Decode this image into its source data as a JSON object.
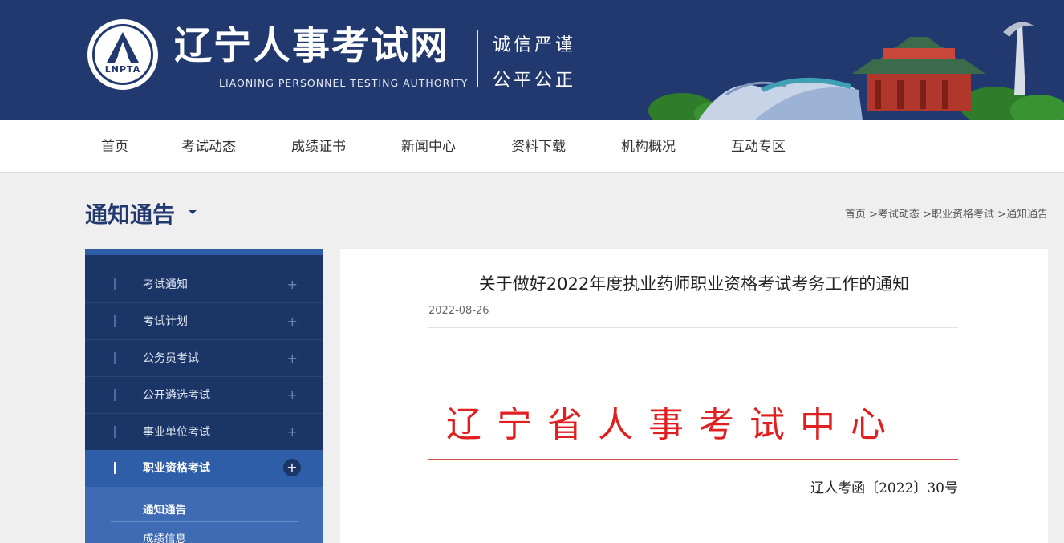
{
  "header": {
    "logo_abbr": "LNPTA",
    "site_title": "辽宁人事考试网",
    "site_subtitle": "LIAONING PERSONNEL TESTING AUTHORITY",
    "slogan_line1": "诚信严谨",
    "slogan_line2": "公平公正",
    "brand_color": "#21396e"
  },
  "nav": {
    "items": [
      "首页",
      "考试动态",
      "成绩证书",
      "新闻中心",
      "资料下载",
      "机构概况",
      "互动专区"
    ]
  },
  "section": {
    "title": "通知通告"
  },
  "breadcrumb": {
    "items": [
      "首页",
      "考试动态",
      "职业资格考试",
      "通知通告"
    ],
    "separator": " >"
  },
  "sidebar": {
    "items": [
      {
        "label": "考试通知"
      },
      {
        "label": "考试计划"
      },
      {
        "label": "公务员考试"
      },
      {
        "label": "公开遴选考试"
      },
      {
        "label": "事业单位考试"
      },
      {
        "label": "职业资格考试",
        "active": true
      }
    ],
    "subitems": [
      {
        "label": "通知通告",
        "active": true
      },
      {
        "label": "成绩信息"
      }
    ],
    "plus_symbol": "+"
  },
  "article": {
    "title": "关于做好2022年度执业药师职业资格考试考务工作的通知",
    "date": "2022-08-26",
    "red_header": "辽宁省人事考试中心",
    "doc_number": "辽人考函〔2022〕30号",
    "red_color": "#e02020"
  }
}
